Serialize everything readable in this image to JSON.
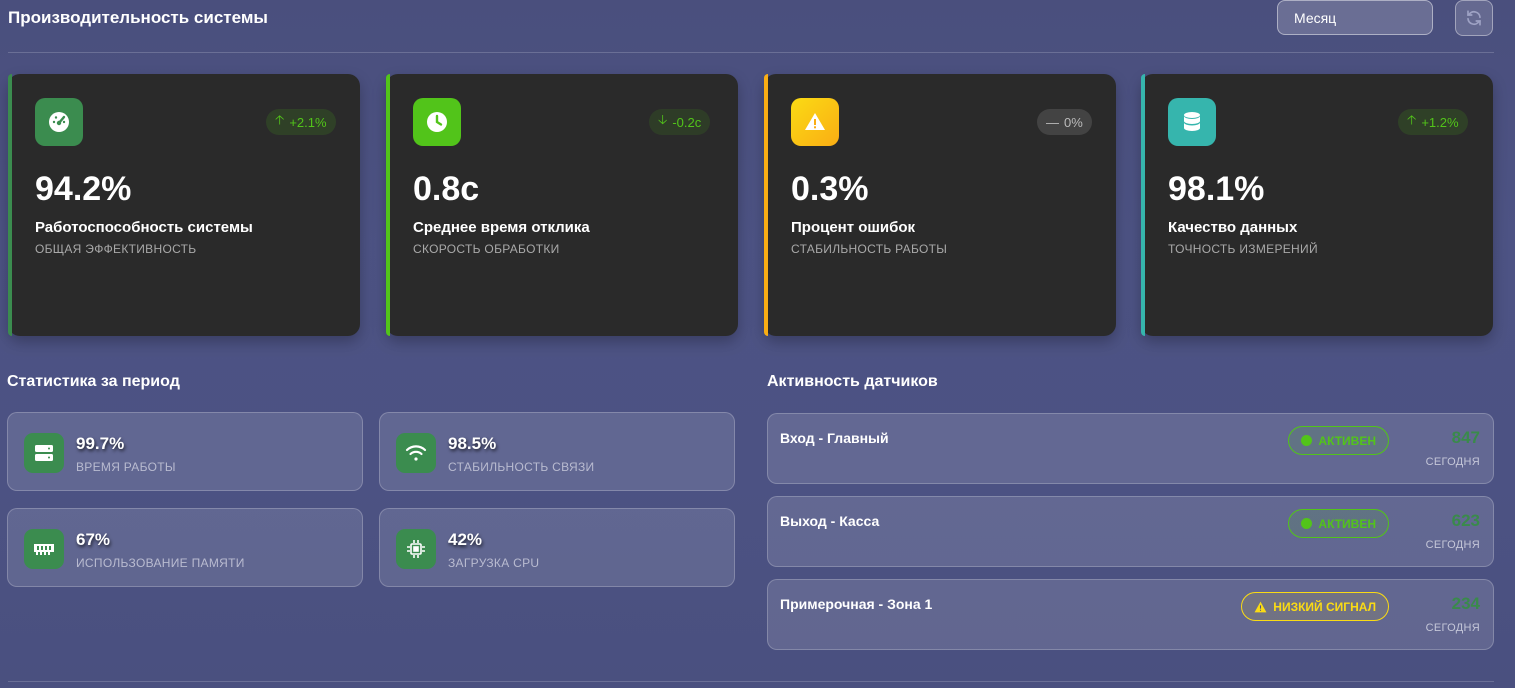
{
  "header": {
    "title": "Производительность системы",
    "period": "Месяц"
  },
  "kpis": [
    {
      "value": "94.2%",
      "label": "Работоспособность системы",
      "sub": "ОБЩАЯ ЭФФЕКТИВНОСТЬ",
      "trend": "+2.1%",
      "icon": "gauge-icon",
      "color": "#3b8c4f"
    },
    {
      "value": "0.8с",
      "label": "Среднее время отклика",
      "sub": "СКОРОСТЬ ОБРАБОТКИ",
      "trend": "-0.2с",
      "icon": "clock-icon",
      "color": "#52c41a"
    },
    {
      "value": "0.3%",
      "label": "Процент ошибок",
      "sub": "СТАБИЛЬНОСТЬ РАБОТЫ",
      "trend": "0%",
      "icon": "warning-icon",
      "color": "#faad14"
    },
    {
      "value": "98.1%",
      "label": "Качество данных",
      "sub": "ТОЧНОСТЬ ИЗМЕРЕНИЙ",
      "trend": "+1.2%",
      "icon": "database-icon",
      "color": "#36b5ad"
    }
  ],
  "stats": {
    "title": "Статистика за период",
    "items": [
      {
        "value": "99.7%",
        "label": "ВРЕМЯ РАБОТЫ",
        "icon": "server-icon"
      },
      {
        "value": "98.5%",
        "label": "СТАБИЛЬНОСТЬ СВЯЗИ",
        "icon": "wifi-icon"
      },
      {
        "value": "67%",
        "label": "ИСПОЛЬЗОВАНИЕ ПАМЯТИ",
        "icon": "memory-icon"
      },
      {
        "value": "42%",
        "label": "ЗАГРУЗКА CPU",
        "icon": "cpu-icon"
      }
    ]
  },
  "sensors": {
    "title": "Активность датчиков",
    "items": [
      {
        "name": "Вход - Главный",
        "status": "АКТИВЕН",
        "count": "847",
        "count_label": "СЕГОДНЯ"
      },
      {
        "name": "Выход - Касса",
        "status": "АКТИВЕН",
        "count": "623",
        "count_label": "СЕГОДНЯ"
      },
      {
        "name": "Примерочная - Зона 1",
        "status": "НИЗКИЙ СИГНАЛ",
        "count": "234",
        "count_label": "СЕГОДНЯ"
      }
    ]
  }
}
